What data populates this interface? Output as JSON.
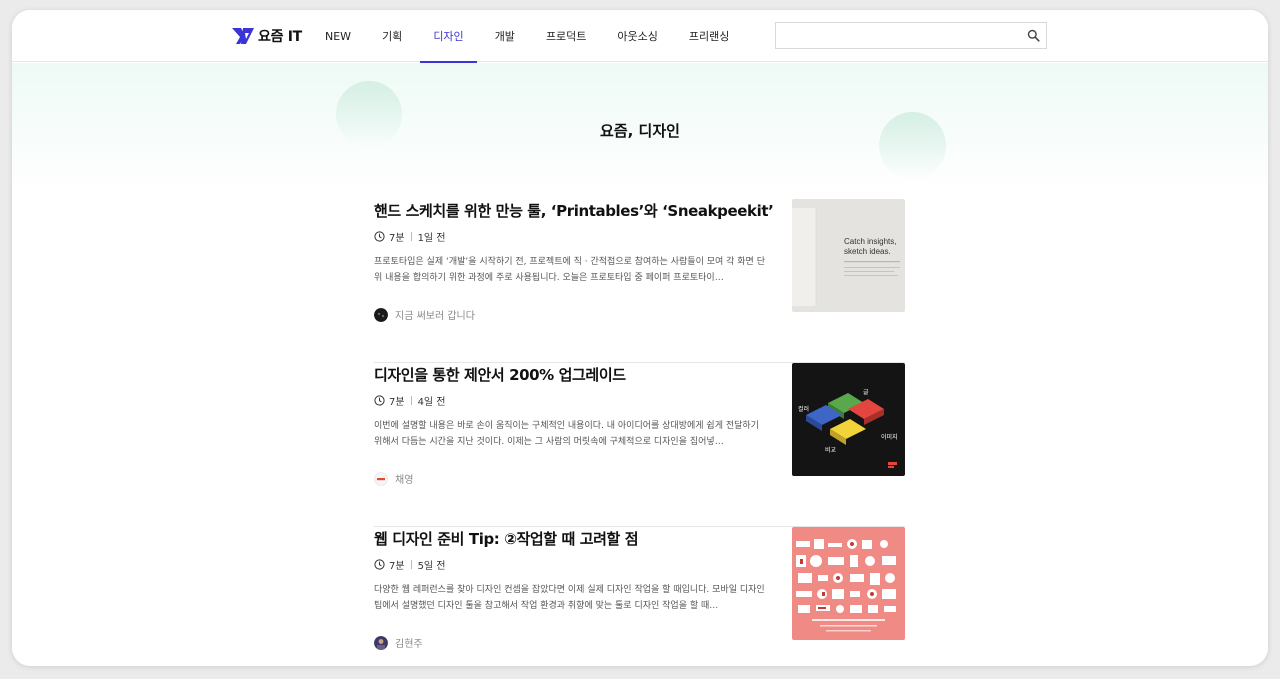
{
  "header": {
    "logo_text": "요즘 IT",
    "nav": [
      {
        "label": "NEW",
        "active": false
      },
      {
        "label": "기획",
        "active": false
      },
      {
        "label": "디자인",
        "active": true
      },
      {
        "label": "개발",
        "active": false
      },
      {
        "label": "프로덕트",
        "active": false
      },
      {
        "label": "아웃소싱",
        "active": false
      },
      {
        "label": "프리랜싱",
        "active": false
      }
    ],
    "search": {
      "placeholder": "",
      "value": ""
    },
    "accent_color": "#3b34d6"
  },
  "hero": {
    "title": "요즘, 디자인"
  },
  "articles": [
    {
      "title": "핸드 스케치를 위한 만능 툴, ‘Printables’와 ‘Sneakpeekit’",
      "read_time": "7분",
      "posted": "1일 전",
      "description": "프로토타입은 실제 ‘개발’을 시작하기 전, 프로젝트에 직 · 간적접으로 참여하는 사람들이 모여 각 화면 단위 내용을 합의하기 위한 과정에 주로 사용됩니다. 오늘은 프로토타입 중 페이퍼 프로토타이…",
      "author": "지금 써보러 갑니다",
      "thumb_text": [
        "Catch insights,",
        "sketch ideas."
      ]
    },
    {
      "title": "디자인을 통한 제안서 200% 업그레이드",
      "read_time": "7분",
      "posted": "4일 전",
      "description": "이번에 설명할 내용은 바로 손이 움직이는 구체적인 내용이다. 내 아이디어를 상대방에게 쉽게 전달하기 위해서 다듬는 시간을 지난 것이다. 이제는 그 사람의 머릿속에 구체적으로 디자인을 집어넣…",
      "author": "채영",
      "thumb_labels": {
        "top": "글",
        "left": "컬러",
        "right": "이미지",
        "bottom": "비교"
      }
    },
    {
      "title": "웹 디자인 준비 Tip: ②작업할 때 고려할 점",
      "read_time": "7분",
      "posted": "5일 전",
      "description": "다양한 웹 레퍼런스를 찾아 디자인 컨셉을 잡았다면 이제 실제 디자인 작업을 할 때입니다. 모바일 디자인 팁에서 설명했던 디자인 툴을 참고해서 작업 환경과 취향에 맞는 툴로 디자인 작업을 할 때…",
      "author": "김현주"
    }
  ]
}
